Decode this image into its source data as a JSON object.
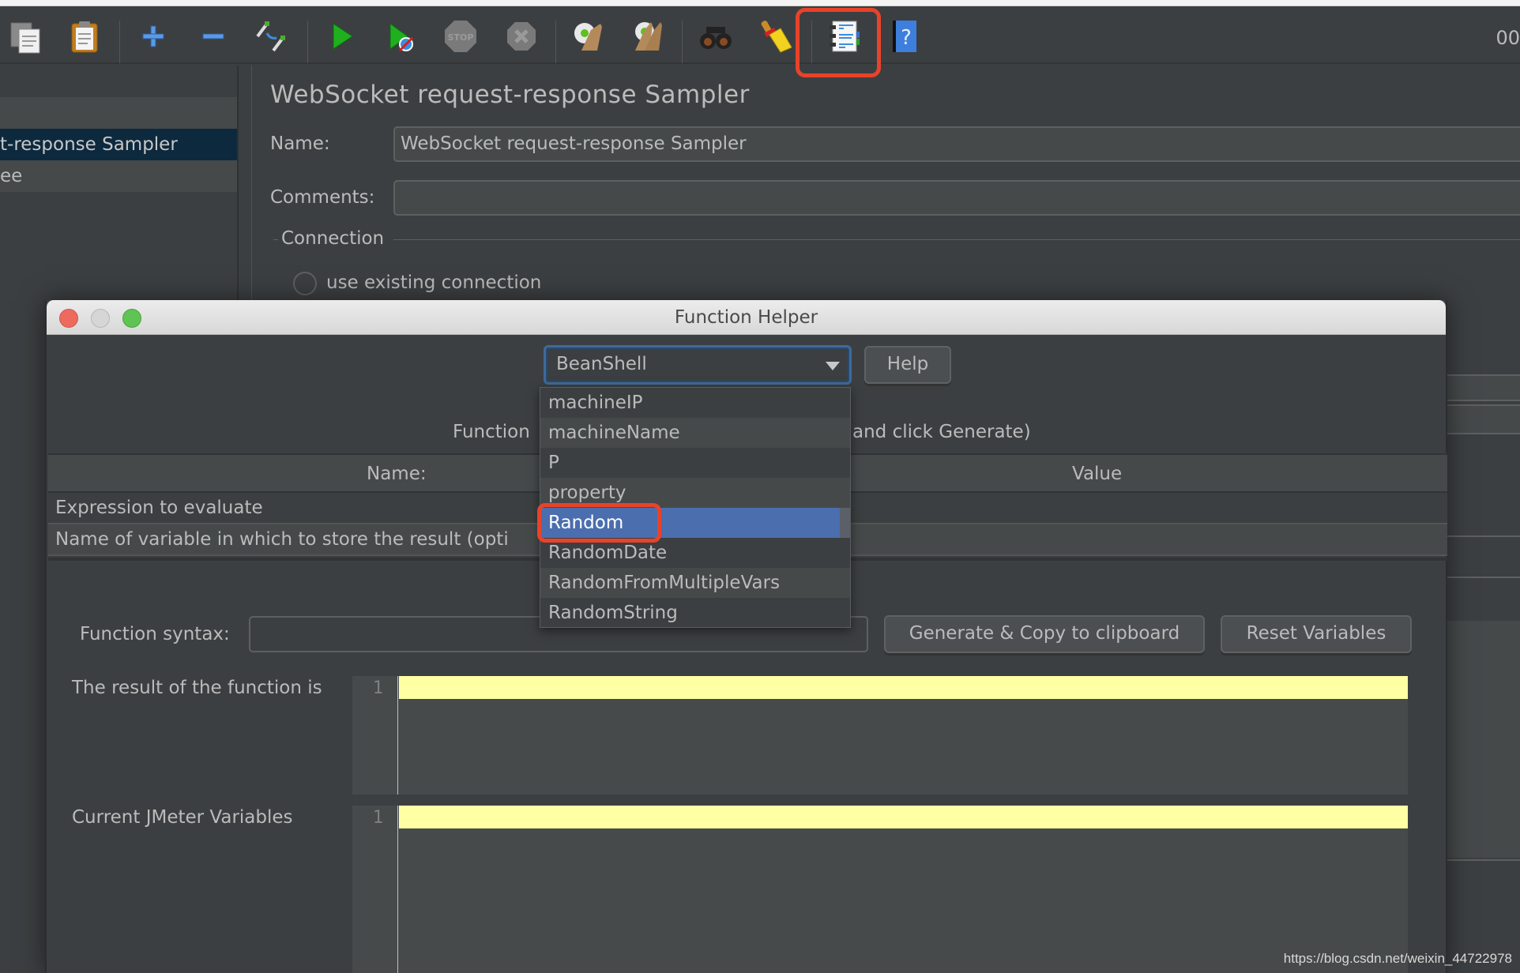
{
  "toolbar": {
    "buttons": [
      {
        "name": "copy",
        "icon": "copy-icon"
      },
      {
        "name": "paste",
        "icon": "paste-icon"
      },
      {
        "name": "expand-all",
        "icon": "plus-icon"
      },
      {
        "name": "collapse-all",
        "icon": "minus-icon"
      },
      {
        "name": "toggle",
        "icon": "toggle-icon"
      },
      {
        "name": "start",
        "icon": "play-icon"
      },
      {
        "name": "start-no-pauses",
        "icon": "play-no-timers-icon"
      },
      {
        "name": "stop",
        "icon": "stop-icon"
      },
      {
        "name": "shutdown",
        "icon": "shutdown-icon"
      },
      {
        "name": "clear",
        "icon": "clear-icon"
      },
      {
        "name": "clear-all",
        "icon": "clear-all-icon"
      },
      {
        "name": "search",
        "icon": "binoculars-icon"
      },
      {
        "name": "reset-search",
        "icon": "broom-icon"
      },
      {
        "name": "function-helper",
        "icon": "function-helper-icon",
        "highlighted": true
      },
      {
        "name": "help",
        "icon": "help-book-icon"
      }
    ],
    "timer_text": "00"
  },
  "tree": {
    "items": [
      {
        "label": "",
        "selected": false
      },
      {
        "label": "t-response Sampler",
        "selected": true
      },
      {
        "label": "ee",
        "selected": false
      }
    ]
  },
  "panel": {
    "title": "WebSocket request-response Sampler",
    "name_label": "Name:",
    "name_value": "WebSocket request-response Sampler",
    "comments_label": "Comments:",
    "comments_value": "",
    "connection_label": "Connection",
    "radio_use_existing": "use existing connection"
  },
  "dialog": {
    "title": "Function Helper",
    "combo_value": "BeanShell",
    "help_button": "Help",
    "instruction_left": "Function",
    "instruction_right": "and click Generate)",
    "table": {
      "headers": [
        "Name:",
        "Value"
      ],
      "rows": [
        {
          "name": "Expression to evaluate",
          "value": ""
        },
        {
          "name": "Name of variable in which to store the result (opti",
          "value": ""
        }
      ]
    },
    "function_syntax_label": "Function syntax:",
    "function_syntax_value": "",
    "generate_button": "Generate & Copy to clipboard",
    "reset_button": "Reset Variables",
    "result_label": "The result of the function is",
    "result_line": "1",
    "vars_label": "Current JMeter Variables",
    "vars_line": "1",
    "dropdown": {
      "items": [
        "machineIP",
        "machineName",
        "P",
        "property",
        "Random",
        "RandomDate",
        "RandomFromMultipleVars",
        "RandomString"
      ],
      "selected": "Random"
    }
  },
  "watermark": "https://blog.csdn.net/weixin_44722978",
  "colors": {
    "background": "#3c3f41",
    "selection": "#4b6eaf",
    "highlight_box": "#e8432a",
    "current_line": "#ffffa4",
    "tree_selection": "#0d293e"
  }
}
